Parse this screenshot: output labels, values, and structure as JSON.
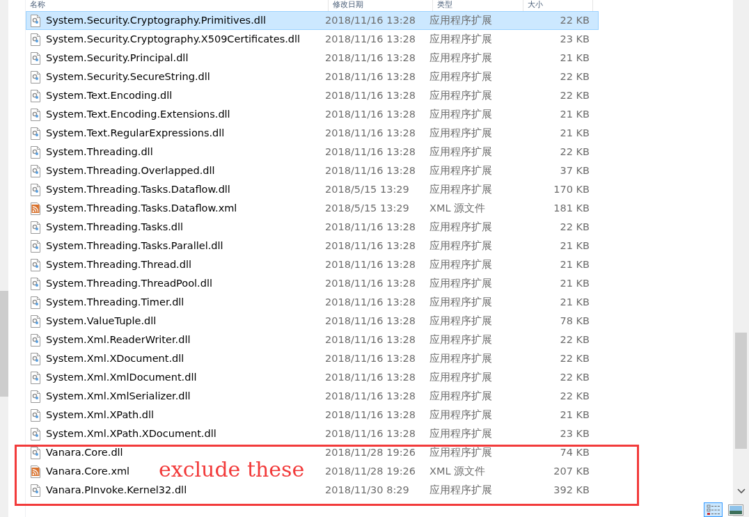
{
  "columns": [
    "名称",
    "修改日期",
    "类型",
    "大小"
  ],
  "files": [
    {
      "name": "System.Security.Cryptography.Primitives.dll",
      "date": "2018/11/16 13:28",
      "type": "应用程序扩展",
      "size": "22 KB",
      "kind": "dll",
      "selected": true
    },
    {
      "name": "System.Security.Cryptography.X509Certificates.dll",
      "date": "2018/11/16 13:28",
      "type": "应用程序扩展",
      "size": "23 KB",
      "kind": "dll",
      "selected": false
    },
    {
      "name": "System.Security.Principal.dll",
      "date": "2018/11/16 13:28",
      "type": "应用程序扩展",
      "size": "21 KB",
      "kind": "dll",
      "selected": false
    },
    {
      "name": "System.Security.SecureString.dll",
      "date": "2018/11/16 13:28",
      "type": "应用程序扩展",
      "size": "22 KB",
      "kind": "dll",
      "selected": false
    },
    {
      "name": "System.Text.Encoding.dll",
      "date": "2018/11/16 13:28",
      "type": "应用程序扩展",
      "size": "22 KB",
      "kind": "dll",
      "selected": false
    },
    {
      "name": "System.Text.Encoding.Extensions.dll",
      "date": "2018/11/16 13:28",
      "type": "应用程序扩展",
      "size": "21 KB",
      "kind": "dll",
      "selected": false
    },
    {
      "name": "System.Text.RegularExpressions.dll",
      "date": "2018/11/16 13:28",
      "type": "应用程序扩展",
      "size": "21 KB",
      "kind": "dll",
      "selected": false
    },
    {
      "name": "System.Threading.dll",
      "date": "2018/11/16 13:28",
      "type": "应用程序扩展",
      "size": "22 KB",
      "kind": "dll",
      "selected": false
    },
    {
      "name": "System.Threading.Overlapped.dll",
      "date": "2018/11/16 13:28",
      "type": "应用程序扩展",
      "size": "37 KB",
      "kind": "dll",
      "selected": false
    },
    {
      "name": "System.Threading.Tasks.Dataflow.dll",
      "date": "2018/5/15 13:29",
      "type": "应用程序扩展",
      "size": "170 KB",
      "kind": "dll",
      "selected": false
    },
    {
      "name": "System.Threading.Tasks.Dataflow.xml",
      "date": "2018/5/15 13:29",
      "type": "XML 源文件",
      "size": "181 KB",
      "kind": "xml",
      "selected": false
    },
    {
      "name": "System.Threading.Tasks.dll",
      "date": "2018/11/16 13:28",
      "type": "应用程序扩展",
      "size": "22 KB",
      "kind": "dll",
      "selected": false
    },
    {
      "name": "System.Threading.Tasks.Parallel.dll",
      "date": "2018/11/16 13:28",
      "type": "应用程序扩展",
      "size": "21 KB",
      "kind": "dll",
      "selected": false
    },
    {
      "name": "System.Threading.Thread.dll",
      "date": "2018/11/16 13:28",
      "type": "应用程序扩展",
      "size": "21 KB",
      "kind": "dll",
      "selected": false
    },
    {
      "name": "System.Threading.ThreadPool.dll",
      "date": "2018/11/16 13:28",
      "type": "应用程序扩展",
      "size": "21 KB",
      "kind": "dll",
      "selected": false
    },
    {
      "name": "System.Threading.Timer.dll",
      "date": "2018/11/16 13:28",
      "type": "应用程序扩展",
      "size": "21 KB",
      "kind": "dll",
      "selected": false
    },
    {
      "name": "System.ValueTuple.dll",
      "date": "2018/11/16 13:28",
      "type": "应用程序扩展",
      "size": "78 KB",
      "kind": "dll",
      "selected": false
    },
    {
      "name": "System.Xml.ReaderWriter.dll",
      "date": "2018/11/16 13:28",
      "type": "应用程序扩展",
      "size": "22 KB",
      "kind": "dll",
      "selected": false
    },
    {
      "name": "System.Xml.XDocument.dll",
      "date": "2018/11/16 13:28",
      "type": "应用程序扩展",
      "size": "22 KB",
      "kind": "dll",
      "selected": false
    },
    {
      "name": "System.Xml.XmlDocument.dll",
      "date": "2018/11/16 13:28",
      "type": "应用程序扩展",
      "size": "22 KB",
      "kind": "dll",
      "selected": false
    },
    {
      "name": "System.Xml.XmlSerializer.dll",
      "date": "2018/11/16 13:28",
      "type": "应用程序扩展",
      "size": "22 KB",
      "kind": "dll",
      "selected": false
    },
    {
      "name": "System.Xml.XPath.dll",
      "date": "2018/11/16 13:28",
      "type": "应用程序扩展",
      "size": "21 KB",
      "kind": "dll",
      "selected": false
    },
    {
      "name": "System.Xml.XPath.XDocument.dll",
      "date": "2018/11/16 13:28",
      "type": "应用程序扩展",
      "size": "23 KB",
      "kind": "dll",
      "selected": false
    },
    {
      "name": "Vanara.Core.dll",
      "date": "2018/11/28 19:26",
      "type": "应用程序扩展",
      "size": "74 KB",
      "kind": "dll",
      "selected": false
    },
    {
      "name": "Vanara.Core.xml",
      "date": "2018/11/28 19:26",
      "type": "XML 源文件",
      "size": "207 KB",
      "kind": "xml",
      "selected": false
    },
    {
      "name": "Vanara.PInvoke.Kernel32.dll",
      "date": "2018/11/30 8:29",
      "type": "应用程序扩展",
      "size": "392 KB",
      "kind": "dll",
      "selected": false
    }
  ],
  "annotation": {
    "text": "exclude these"
  },
  "view_buttons": [
    {
      "kind": "details",
      "selected": true
    },
    {
      "kind": "large_icons",
      "selected": false
    }
  ]
}
